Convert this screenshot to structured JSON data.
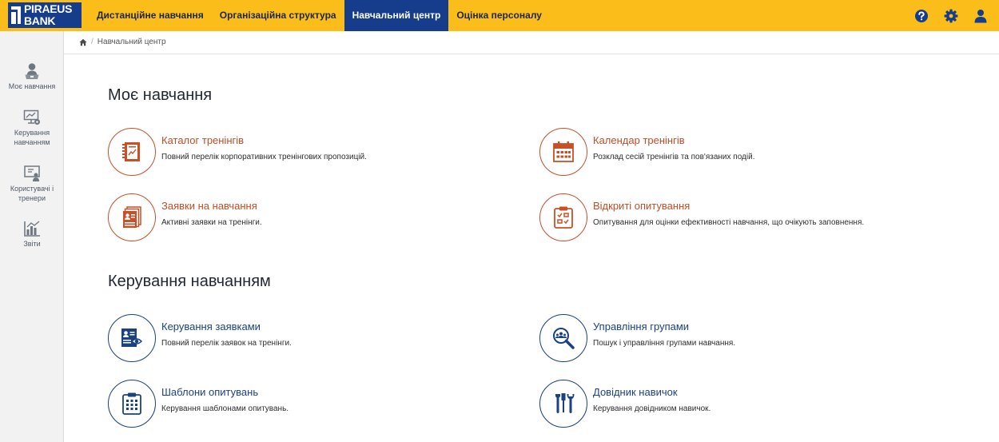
{
  "brand": {
    "line1": "PIRAEUS",
    "line2": "BANK",
    "color": "#163d8c",
    "accent": "#fbbd19"
  },
  "nav": {
    "items": [
      {
        "label": "Дистанційне навчання",
        "active": false
      },
      {
        "label": "Організаційна структура",
        "active": false
      },
      {
        "label": "Навчальний центр",
        "active": true
      },
      {
        "label": "Оцінка персоналу",
        "active": false
      }
    ]
  },
  "top_icons": [
    "help-icon",
    "gear-icon",
    "user-icon"
  ],
  "breadcrumb": {
    "home_icon": "home-icon",
    "current": "Навчальний центр"
  },
  "sidebar": {
    "items": [
      {
        "label": "Моє навчання",
        "icon": "learner-icon"
      },
      {
        "label": "Керування навчанням",
        "icon": "presentation-settings-icon"
      },
      {
        "label": "Користувачі і тренери",
        "icon": "users-board-icon"
      },
      {
        "label": "Звіти",
        "icon": "reports-chart-icon"
      }
    ]
  },
  "sections": [
    {
      "title": "Моє навчання",
      "color": "#c14d25",
      "cards": [
        {
          "title": "Каталог тренінгів",
          "desc": "Повний перелік корпоративних тренінгових пропозицій.",
          "icon": "catalog-icon"
        },
        {
          "title": "Календар тренінгів",
          "desc": "Розклад сесій тренінгів та пов'язаних подій.",
          "icon": "calendar-icon"
        },
        {
          "title": "Заявки на навчання",
          "desc": "Активні заявки на тренінги.",
          "icon": "requests-icon"
        },
        {
          "title": "Відкриті опитування",
          "desc": "Опитування для оцінки ефективності навчання, що очікують заповнення.",
          "icon": "survey-checklist-icon"
        }
      ]
    },
    {
      "title": "Керування навчанням",
      "color": "#1a4181",
      "cards": [
        {
          "title": "Керування заявками",
          "desc": "Повний перелік заявок на тренінги.",
          "icon": "manage-requests-icon"
        },
        {
          "title": "Управління групами",
          "desc": "Пошук і управління групами навчання.",
          "icon": "group-search-icon"
        },
        {
          "title": "Шаблони опитувань",
          "desc": "Керування шаблонами опитувань.",
          "icon": "survey-template-icon"
        },
        {
          "title": "Довідник навичок",
          "desc": "Керування довідником навичок.",
          "icon": "tools-icon"
        }
      ]
    }
  ]
}
